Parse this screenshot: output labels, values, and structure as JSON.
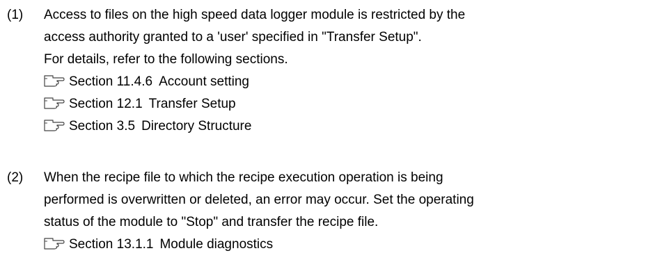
{
  "items": [
    {
      "marker": "(1)",
      "lines": [
        "Access to files on the high speed data logger module is restricted by the",
        "access authority granted to a 'user' specified in \"Transfer Setup\".",
        "For details, refer to the following sections."
      ],
      "refs": [
        {
          "section": "Section 11.4.6",
          "title": "Account setting"
        },
        {
          "section": "Section 12.1",
          "title": "Transfer Setup"
        },
        {
          "section": "Section 3.5",
          "title": "Directory Structure"
        }
      ]
    },
    {
      "marker": "(2)",
      "lines": [
        "When the recipe file to which the recipe execution operation is being",
        "performed is overwritten or deleted, an error may occur. Set the operating",
        "status of the module to \"Stop\" and transfer the recipe file."
      ],
      "refs": [
        {
          "section": "Section 13.1.1",
          "title": "Module diagnostics"
        }
      ]
    }
  ]
}
